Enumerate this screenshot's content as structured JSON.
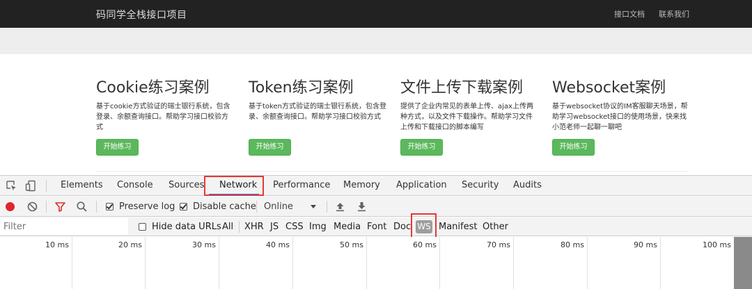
{
  "navbar": {
    "brand": "码同学全栈接口项目",
    "links": [
      "接口文档",
      "联系我们"
    ]
  },
  "cards": [
    {
      "title": "Cookie练习案例",
      "desc": "基于cookie方式验证的瑞士银行系统，包含登录、余额查询接口。帮助学习接口校验方式",
      "button": "开始练习"
    },
    {
      "title": "Token练习案例",
      "desc": "基于token方式验证的瑞士银行系统，包含登录、余额查询接口。帮助学习接口校验方式",
      "button": "开始练习"
    },
    {
      "title": "文件上传下载案例",
      "desc": "提供了企业内常见的表单上传、ajax上传两种方式，以及文件下载操作。帮助学习文件上传和下载接口的脚本编写",
      "button": "开始练习"
    },
    {
      "title": "Websocket案例",
      "desc": "基于websocket协议的IM客服聊天场景，帮助学习websocket接口的使用场景，快来找小范老师一起聊一聊吧",
      "button": "开始练习"
    }
  ],
  "devtools": {
    "tabs": [
      "Elements",
      "Console",
      "Sources",
      "Network",
      "Performance",
      "Memory",
      "Application",
      "Security",
      "Audits"
    ],
    "active_tab": "Network",
    "toolbar": {
      "preserve_log": "Preserve log",
      "preserve_log_checked": true,
      "disable_cache": "Disable cache",
      "disable_cache_checked": true,
      "throttle": "Online"
    },
    "filter": {
      "placeholder": "Filter",
      "hide_data_urls": "Hide data URLs",
      "hide_data_urls_checked": false,
      "types": [
        "All",
        "XHR",
        "JS",
        "CSS",
        "Img",
        "Media",
        "Font",
        "Doc",
        "WS",
        "Manifest",
        "Other"
      ],
      "selected_type": "WS"
    },
    "timeline_ticks": [
      "10 ms",
      "20 ms",
      "30 ms",
      "40 ms",
      "50 ms",
      "60 ms",
      "70 ms",
      "80 ms",
      "90 ms",
      "100 ms"
    ]
  },
  "colors": {
    "navbar_bg": "#222222",
    "start_button": "#5cb85c",
    "highlight_box": "#e53935",
    "record_red": "#e0242c",
    "filter_red": "#d93025",
    "tab_underline": "#1a73e8"
  },
  "icons": [
    "inspect-element-icon",
    "device-toolbar-icon",
    "record-icon",
    "clear-icon",
    "filter-icon",
    "search-icon",
    "import-har-icon",
    "export-har-icon",
    "throttle-dropdown-arrow-icon"
  ]
}
